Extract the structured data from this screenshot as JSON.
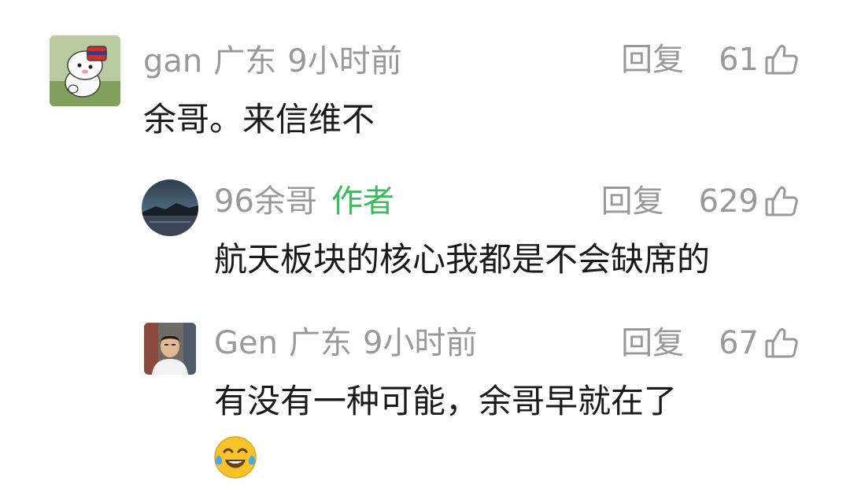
{
  "comments": [
    {
      "username": "gan",
      "location": "广东",
      "time": "9小时前",
      "reply_label": "回复",
      "likes": "61",
      "text": "余哥。来信维不",
      "avatar": "dog-sticker-avatar"
    },
    {
      "username": "96余哥",
      "badge": "作者",
      "reply_label": "回复",
      "likes": "629",
      "text": "航天板块的核心我都是不会缺席的",
      "avatar": "night-sky-avatar"
    },
    {
      "username": "Gen",
      "location": "广东",
      "time": "9小时前",
      "reply_label": "回复",
      "likes": "67",
      "text": "有没有一种可能，余哥早就在了",
      "emoji": "tears-of-joy-emoji",
      "avatar": "person-photo-avatar"
    }
  ],
  "colors": {
    "meta_gray": "#999999",
    "author_green": "#3fb860",
    "text_dark": "#1a1a1a"
  }
}
